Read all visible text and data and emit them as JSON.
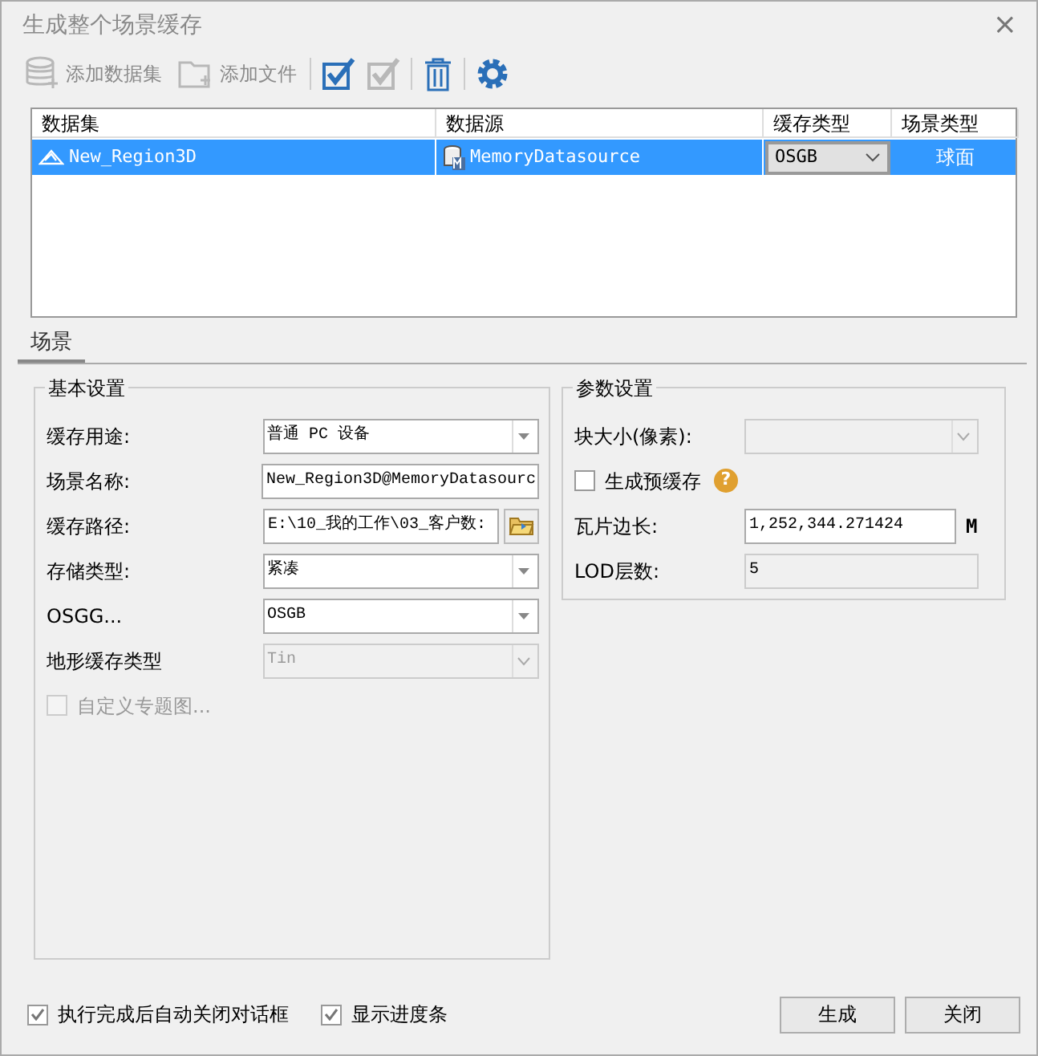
{
  "window": {
    "title": "生成整个场景缓存",
    "close": "×"
  },
  "toolbar": [
    {
      "kind": "db",
      "label": "添加数据集",
      "disabled": true
    },
    {
      "kind": "folder",
      "label": "添加文件",
      "disabled": true
    },
    {
      "kind": "select-all",
      "disabled": false
    },
    {
      "kind": "select-invert",
      "disabled": true
    },
    {
      "kind": "delete",
      "disabled": false
    },
    {
      "kind": "settings",
      "disabled": false
    }
  ],
  "table": {
    "columns": [
      "数据集",
      "数据源",
      "缓存类型",
      "场景类型"
    ],
    "rows": [
      {
        "dataset": "New_Region3D",
        "datasource": "MemoryDatasource",
        "cache_type": "OSGB",
        "scene_type": "球面",
        "selected": true
      }
    ]
  },
  "tabs": [
    {
      "label": "场景",
      "selected": true
    }
  ],
  "basic_settings": {
    "title": "基本设置",
    "fields": [
      {
        "kind": "select",
        "label": "缓存用途:",
        "value": "普通 PC 设备",
        "disabled": false
      },
      {
        "kind": "text",
        "label": "场景名称:",
        "value": "New_Region3D@MemoryDatasourc",
        "disabled": false
      },
      {
        "kind": "path",
        "label": "缓存路径:",
        "value": "E:\\10_我的工作\\03_客户数:",
        "disabled": false
      },
      {
        "kind": "select",
        "label": "存储类型:",
        "value": "紧凑",
        "disabled": false
      },
      {
        "kind": "select",
        "label": "OSGG...",
        "value": "OSGB",
        "disabled": false
      },
      {
        "kind": "select",
        "label": "地形缓存类型",
        "value": "Tin",
        "disabled": true
      },
      {
        "kind": "check",
        "label": "自定义专题图...",
        "checked": false,
        "disabled": true
      }
    ]
  },
  "param_settings": {
    "title": "参数设置",
    "fields": [
      {
        "kind": "select",
        "label": "块大小(像素):",
        "disabled": true
      },
      {
        "kind": "check",
        "label": "生成预缓存",
        "checked": false,
        "disabled": false,
        "help": "?"
      },
      {
        "kind": "text",
        "label": "瓦片边长:",
        "value": "1,252,344.271424",
        "unit": "M",
        "disabled": false
      },
      {
        "kind": "readonly",
        "label": "LOD层数:",
        "value": "5",
        "disabled": true
      }
    ]
  },
  "footer": {
    "options": [
      {
        "label": "执行完成后自动关闭对话框",
        "checked": true
      },
      {
        "label": "显示进度条",
        "checked": true
      }
    ],
    "buttons": [
      "生成",
      "关闭"
    ]
  }
}
